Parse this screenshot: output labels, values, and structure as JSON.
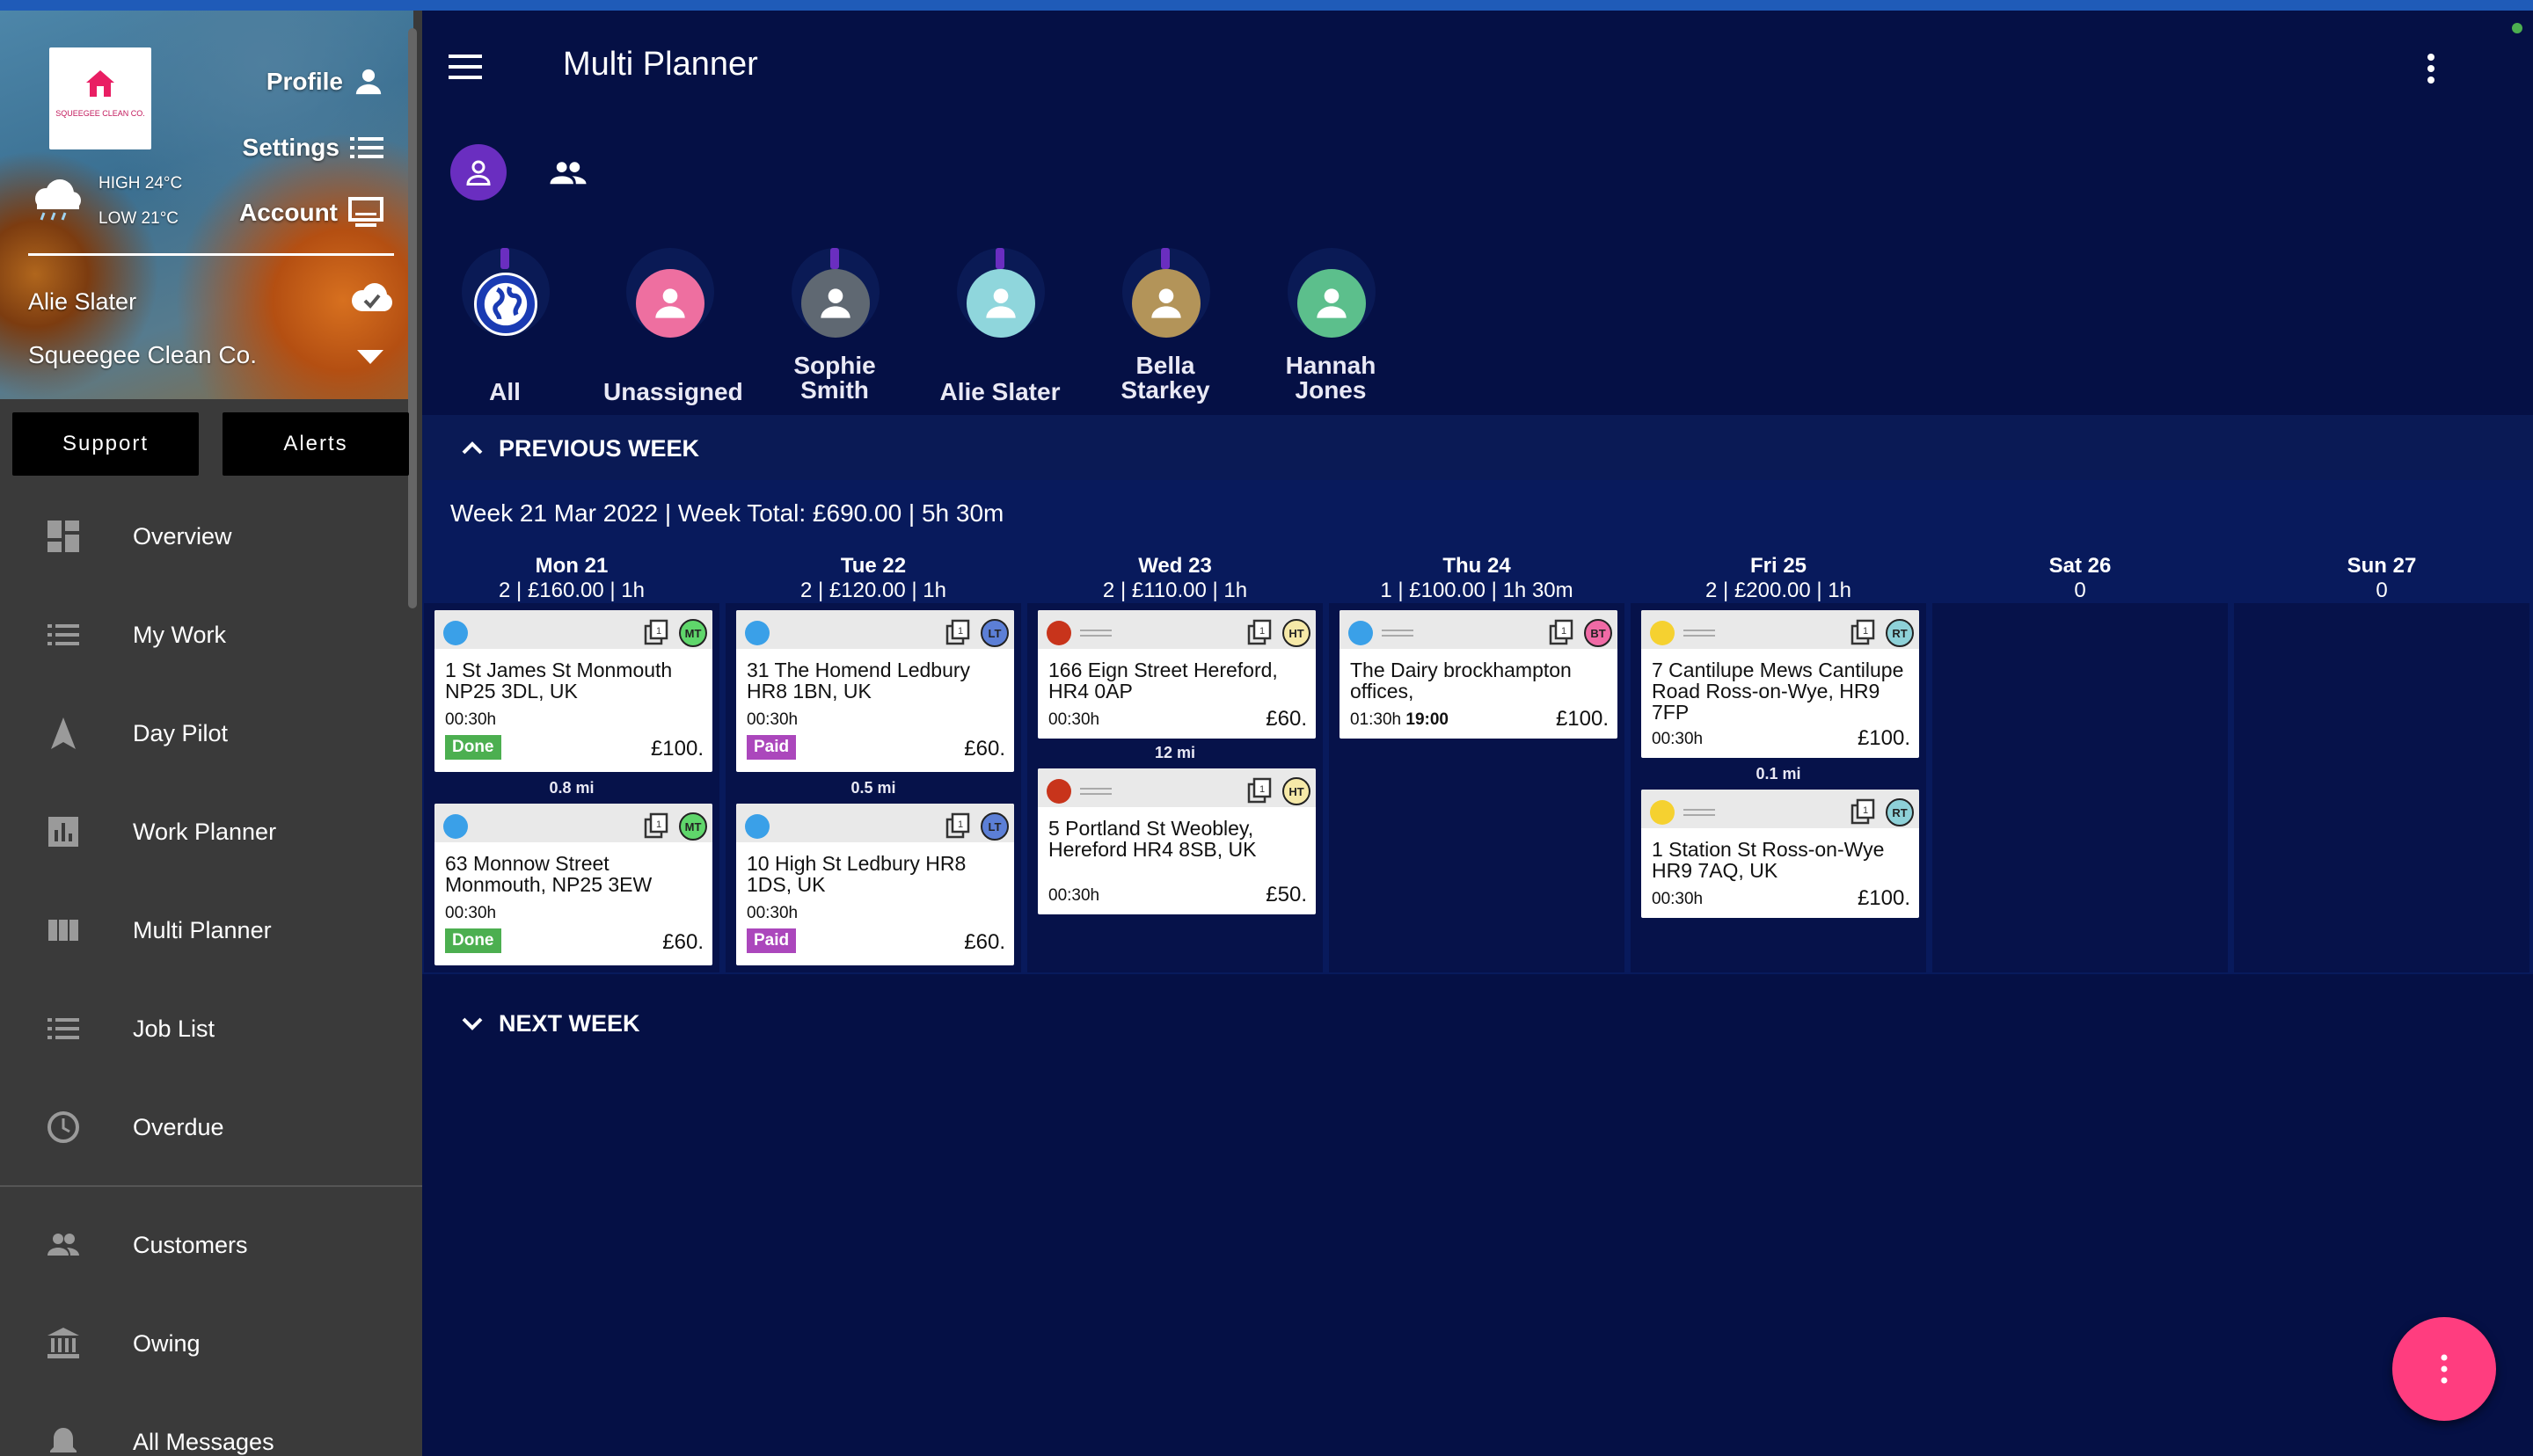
{
  "app": {
    "title": "Multi Planner"
  },
  "sidebar": {
    "logo_text": "SQUEEGEE CLEAN CO.",
    "profile": "Profile",
    "settings": "Settings",
    "account": "Account",
    "weather_high": "HIGH 24°C",
    "weather_low": "LOW 21°C",
    "user_name": "Alie Slater",
    "company": "Squeegee Clean Co.",
    "support": "Support",
    "alerts": "Alerts",
    "items": [
      {
        "label": "Overview",
        "icon": "dashboard-icon"
      },
      {
        "label": "My Work",
        "icon": "list-icon"
      },
      {
        "label": "Day Pilot",
        "icon": "navigation-icon"
      },
      {
        "label": "Work Planner",
        "icon": "bar-chart-icon"
      },
      {
        "label": "Multi Planner",
        "icon": "columns-icon"
      },
      {
        "label": "Job List",
        "icon": "list-icon"
      },
      {
        "label": "Overdue",
        "icon": "clock-icon"
      },
      {
        "label": "Customers",
        "icon": "people-icon"
      },
      {
        "label": "Owing",
        "icon": "bank-icon"
      },
      {
        "label": "All Messages",
        "icon": "bell-icon"
      }
    ]
  },
  "employees": [
    {
      "name": "All",
      "color": "#1a3bb3",
      "icon": "globe-icon"
    },
    {
      "name": "Unassigned",
      "color": "#ee6fa0",
      "icon": "person-icon"
    },
    {
      "name": "Sophie Smith",
      "color": "#5f6872",
      "icon": "person-icon"
    },
    {
      "name": "Alie Slater",
      "color": "#8fd6dc",
      "icon": "person-icon"
    },
    {
      "name": "Bella Starkey",
      "color": "#b39459",
      "icon": "person-icon"
    },
    {
      "name": "Hannah Jones",
      "color": "#5cbf8c",
      "icon": "person-icon"
    }
  ],
  "sections": {
    "previous": "PREVIOUS WEEK",
    "next": "NEXT WEEK"
  },
  "week_summary": "Week 21 Mar 2022 | Week Total: £690.00 | 5h 30m",
  "days": [
    {
      "name": "Mon 21",
      "summary": "2 | £160.00 | 1h"
    },
    {
      "name": "Tue 22",
      "summary": "2 | £120.00 | 1h"
    },
    {
      "name": "Wed 23",
      "summary": "2 | £110.00 | 1h"
    },
    {
      "name": "Thu 24",
      "summary": "1 | £100.00 | 1h 30m"
    },
    {
      "name": "Fri 25",
      "summary": "2 | £200.00 | 1h"
    },
    {
      "name": "Sat 26",
      "summary": "0"
    },
    {
      "name": "Sun 27",
      "summary": "0"
    }
  ],
  "jobs": [
    {
      "addr": "1 St James St Monmouth NP25 3DL, UK",
      "dur": "00:30h",
      "price": "£100.",
      "status": "Done",
      "status_color": "#4caf50",
      "dot": "#3aa0e8",
      "ini": "MT",
      "ini_color": "#5fd66b",
      "lines": false
    },
    {
      "addr": "63 Monnow Street Monmouth, NP25 3EW",
      "dur": "00:30h",
      "price": "£60.",
      "status": "Done",
      "status_color": "#4caf50",
      "dot": "#3aa0e8",
      "ini": "MT",
      "ini_color": "#5fd66b",
      "lines": false
    },
    {
      "addr": "31 The Homend Ledbury HR8 1BN, UK",
      "dur": "00:30h",
      "price": "£60.",
      "status": "Paid",
      "status_color": "#ab47bc",
      "dot": "#3aa0e8",
      "ini": "LT",
      "ini_color": "#5c7fd6",
      "lines": false
    },
    {
      "addr": "10 High St Ledbury HR8 1DS, UK",
      "dur": "00:30h",
      "price": "£60.",
      "status": "Paid",
      "status_color": "#ab47bc",
      "dot": "#3aa0e8",
      "ini": "LT",
      "ini_color": "#5c7fd6",
      "lines": false
    },
    {
      "addr": "166 Eign Street Hereford, HR4 0AP",
      "dur": "00:30h",
      "price": "£60.",
      "status": "",
      "dot": "#c8341b",
      "ini": "HT",
      "ini_color": "#f6e9a8",
      "lines": true
    },
    {
      "addr": "5 Portland St Weobley, Hereford HR4 8SB, UK",
      "dur": "00:30h",
      "price": "£50.",
      "status": "",
      "dot": "#c8341b",
      "ini": "HT",
      "ini_color": "#f6e9a8",
      "lines": true
    },
    {
      "addr": "The Dairy brockhampton offices,",
      "dur": "01:30h",
      "time": "19:00",
      "price": "£100.",
      "status": "",
      "dot": "#3aa0e8",
      "ini": "BT",
      "ini_color": "#f06aa5",
      "lines": true
    },
    {
      "addr": "7 Cantilupe Mews Cantilupe Road Ross-on-Wye, HR9 7FP",
      "dur": "00:30h",
      "price": "£100.",
      "status": "",
      "dot": "#f5d130",
      "ini": "RT",
      "ini_color": "#8ed1d8",
      "lines": true
    },
    {
      "addr": "1 Station St Ross-on-Wye HR9 7AQ, UK",
      "dur": "00:30h",
      "price": "£100.",
      "status": "",
      "dot": "#f5d130",
      "ini": "RT",
      "ini_color": "#8ed1d8",
      "lines": true
    }
  ],
  "distances": [
    "0.8 mi",
    "0.5 mi",
    "12 mi",
    "0.1 mi"
  ]
}
